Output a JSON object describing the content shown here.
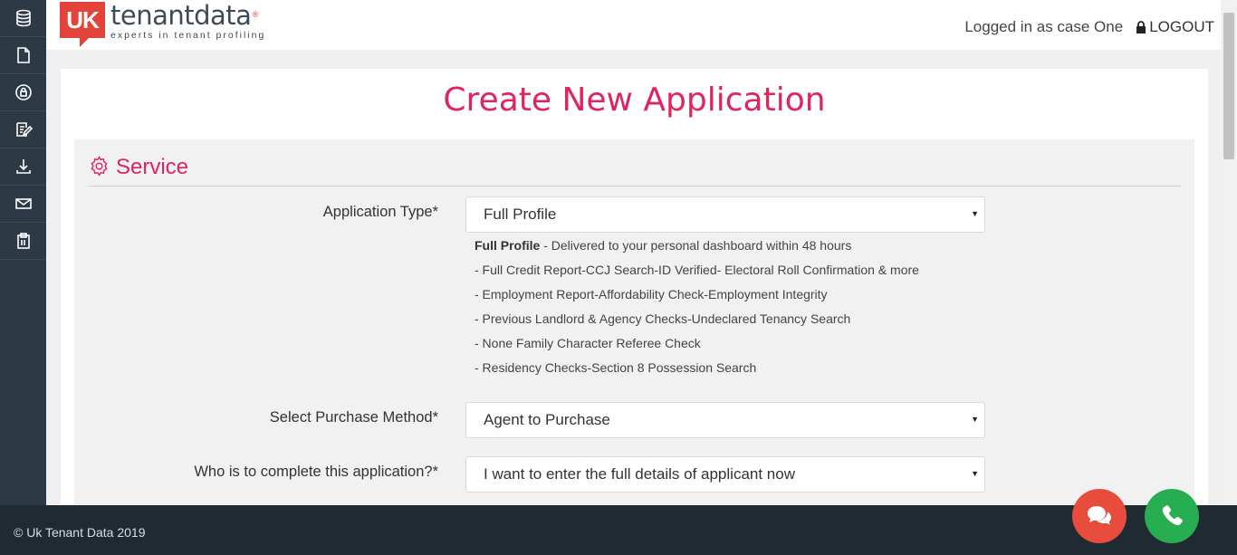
{
  "header": {
    "logo_badge": "UK",
    "logo_word": "tenantdata",
    "logo_reg": "®",
    "logo_tagline": "experts in tenant profiling",
    "logged_in_text": "Logged in as case One",
    "logout_label": "LOGOUT"
  },
  "sidebar": {
    "items": [
      {
        "icon": "database-icon"
      },
      {
        "icon": "document-icon"
      },
      {
        "icon": "lock-circle-icon"
      },
      {
        "icon": "edit-icon"
      },
      {
        "icon": "download-icon"
      },
      {
        "icon": "mail-icon"
      },
      {
        "icon": "clipboard-icon"
      }
    ]
  },
  "page": {
    "title": "Create New Application"
  },
  "service": {
    "section_title": "Service",
    "application_type": {
      "label": "Application Type*",
      "value": "Full Profile"
    },
    "description": {
      "lead_bold": "Full Profile",
      "lead_rest": " - Delivered to your personal dashboard within 48 hours",
      "lines": [
        "- Full Credit Report-CCJ Search-ID Verified- Electoral Roll Confirmation & more",
        "- Employment Report-Affordability Check-Employment Integrity",
        "- Previous Landlord & Agency Checks-Undeclared Tenancy Search",
        "- None Family Character Referee Check",
        "- Residency Checks-Section 8 Possession Search"
      ]
    },
    "purchase_method": {
      "label": "Select Purchase Method*",
      "value": "Agent to Purchase"
    },
    "completer": {
      "label": "Who is to complete this application?*",
      "value": "I want to enter the full details of applicant now"
    },
    "caret": "▼"
  },
  "footer": {
    "copyright": "© Uk Tenant Data 2019"
  },
  "colors": {
    "accent": "#e0245e",
    "sidebar_bg": "#2d3a45",
    "footer_bg": "#202a33",
    "chat_button": "#e74c3c",
    "call_button": "#27ae51"
  }
}
